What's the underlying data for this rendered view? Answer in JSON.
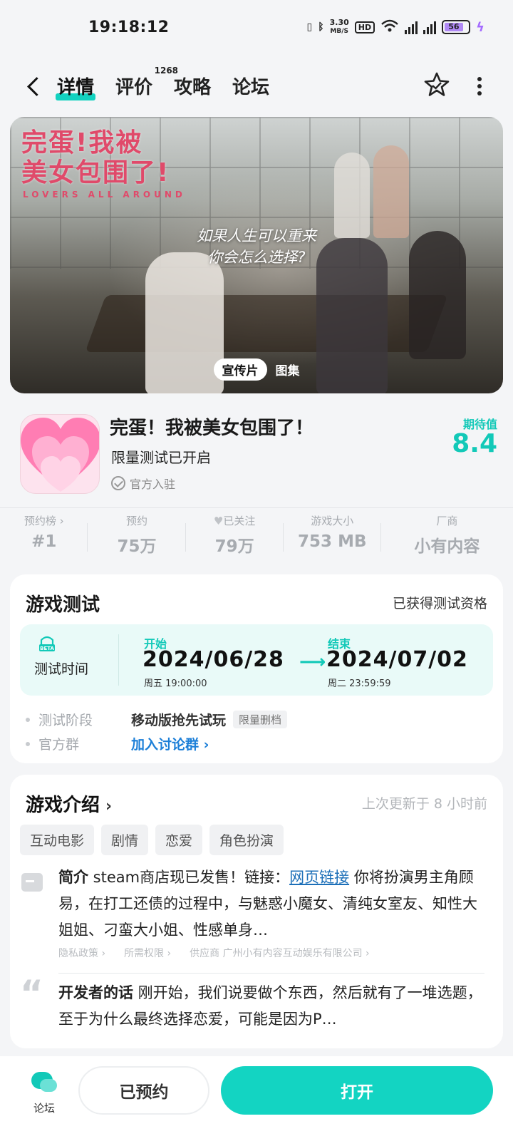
{
  "status_bar": {
    "time": "19:18:12",
    "net_speed_value": "3.30",
    "net_speed_unit": "MB/S",
    "hd": "HD",
    "battery": "56"
  },
  "nav": {
    "tabs": [
      {
        "label": "详情",
        "active": true
      },
      {
        "label": "评价",
        "badge": "1268"
      },
      {
        "label": "攻略"
      },
      {
        "label": "论坛"
      }
    ]
  },
  "banner": {
    "logo_line1": "完蛋!我被",
    "logo_line2": "美女包围了!",
    "logo_sub": "LOVERS ALL AROUND",
    "quote_line1": "如果人生可以重来",
    "quote_line2": "你会怎么选择?",
    "tab_video": "宣传片",
    "tab_gallery": "图集"
  },
  "game": {
    "name": "完蛋！我被美女包围了！",
    "status": "限量测试已开启",
    "official": "官方入驻",
    "expect_label": "期待值",
    "expect_value": "8.4"
  },
  "stats": [
    {
      "label": "预约榜 ›",
      "value": "#1"
    },
    {
      "label": "预约",
      "value": "75万"
    },
    {
      "label": "已关注",
      "value": "79万"
    },
    {
      "label": "游戏大小",
      "value": "753 MB"
    },
    {
      "label": "厂商",
      "value": "小有内容"
    }
  ],
  "test": {
    "title": "游戏测试",
    "right": "已获得测试资格",
    "beta": "BETA",
    "time_label": "测试时间",
    "start_label": "开始",
    "start_date": "2024/06/28",
    "start_time": "周五  19:00:00",
    "end_label": "结束",
    "end_date": "2024/07/02",
    "end_time": "周二  23:59:59",
    "stage_key": "测试阶段",
    "stage_value": "移动版抢先试玩",
    "stage_tag": "限量删档",
    "group_key": "官方群",
    "group_value": "加入讨论群 ›"
  },
  "intro": {
    "title": "游戏介绍",
    "updated": "上次更新于 8 小时前",
    "tags": [
      "互动电影",
      "剧情",
      "恋爱",
      "角色扮演"
    ],
    "label": "简介",
    "text_before": " steam商店现已发售！链接：",
    "link": "网页链接",
    "text_after": " 你将扮演男主角顾易，在打工还债的过程中，与魅惑小魔女、清纯女室友、知性大姐姐、刁蛮大小姐、性感单身…",
    "meta": [
      "隐私政策 ›",
      "所需权限 ›",
      "供应商 广州小有内容互动娱乐有限公司 ›"
    ],
    "dev_label": "开发者的话",
    "dev_text": " 刚开始，我们说要做个东西，然后就有了一堆选题，至于为什么最终选择恋爱，可能是因为P…"
  },
  "bottom": {
    "forum": "论坛",
    "reserved": "已预约",
    "open": "打开"
  },
  "colors": {
    "accent": "#13d4c2",
    "link": "#1c6fb8"
  }
}
